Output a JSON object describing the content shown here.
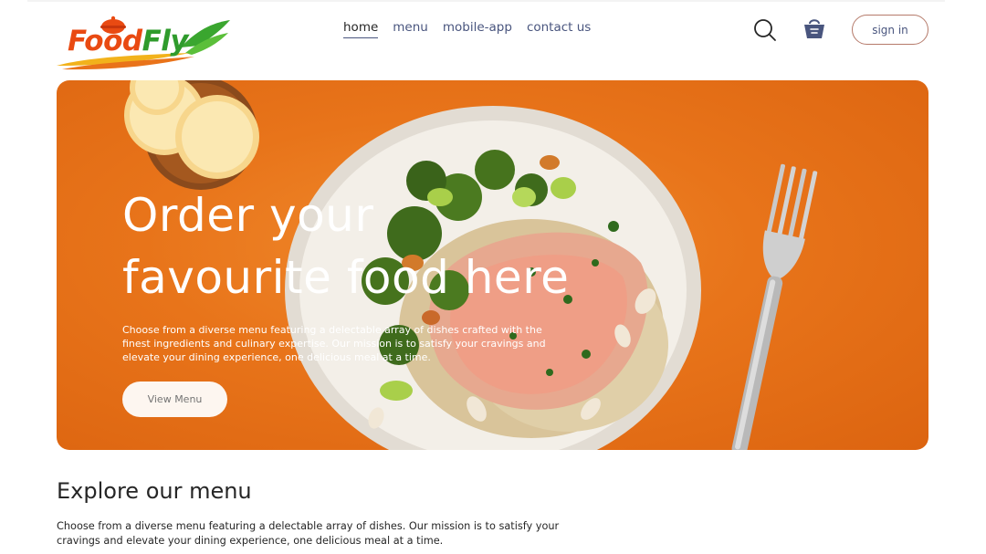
{
  "brand": {
    "name_part1": "Food",
    "name_part2": "Fly"
  },
  "nav": {
    "items": [
      {
        "label": "home",
        "active": true
      },
      {
        "label": "menu",
        "active": false
      },
      {
        "label": "mobile-app",
        "active": false
      },
      {
        "label": "contact us",
        "active": false
      }
    ]
  },
  "header": {
    "search_icon": "search-icon",
    "basket_icon": "basket-icon",
    "signin_label": "sign in"
  },
  "hero": {
    "title_line1": "Order your",
    "title_line2": "favourite food here",
    "description": "Choose from a diverse menu featuring a delectable array of dishes crafted with the finest ingredients and culinary expertise. Our mission is to satisfy your cravings and elevate your dining experience, one delicious meal at a time.",
    "button_label": "View Menu"
  },
  "explore": {
    "title": "Explore our menu",
    "description": "Choose from a diverse menu featuring a delectable array of dishes. Our mission is to satisfy your cravings and elevate your dining experience, one delicious meal at a time."
  },
  "colors": {
    "accent_orange": "#e8741a",
    "logo_orange": "#e94a12",
    "logo_green": "#2f9b2c",
    "nav_text": "#49557e"
  }
}
